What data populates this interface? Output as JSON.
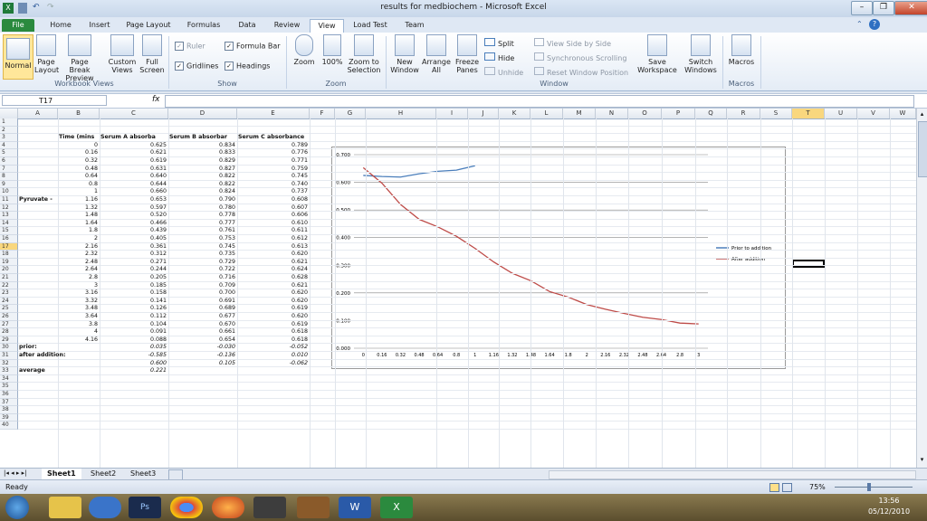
{
  "window": {
    "title": "results for medbiochem  -  Microsoft Excel"
  },
  "tabs": [
    "File",
    "Home",
    "Insert",
    "Page Layout",
    "Formulas",
    "Data",
    "Review",
    "View",
    "Load Test",
    "Team"
  ],
  "ribbon": {
    "workbook_views": {
      "label": "Workbook Views",
      "items": [
        "Normal",
        "Page Layout",
        "Page Break Preview",
        "Custom Views",
        "Full Screen"
      ]
    },
    "show": {
      "label": "Show",
      "items": [
        {
          "text": "Ruler",
          "checked": true,
          "enabled": false
        },
        {
          "text": "Formula Bar",
          "checked": true,
          "enabled": true
        },
        {
          "text": "Gridlines",
          "checked": true,
          "enabled": true
        },
        {
          "text": "Headings",
          "checked": true,
          "enabled": true
        }
      ]
    },
    "zoom": {
      "label": "Zoom",
      "items": [
        "Zoom",
        "100%",
        "Zoom to Selection"
      ]
    },
    "window": {
      "label": "Window",
      "items": [
        "New Window",
        "Arrange All",
        "Freeze Panes",
        "Split",
        "Hide",
        "Unhide",
        "View Side by Side",
        "Synchronous Scrolling",
        "Reset Window Position",
        "Save Workspace",
        "Switch Windows"
      ]
    },
    "macros": {
      "label": "Macros",
      "items": [
        "Macros"
      ]
    }
  },
  "formula_bar": {
    "name_box": "T17",
    "fx": "fx",
    "value": ""
  },
  "columns": [
    "A",
    "B",
    "C",
    "D",
    "E",
    "F",
    "G",
    "H",
    "I",
    "J",
    "K",
    "L",
    "M",
    "N",
    "O",
    "P",
    "Q",
    "R",
    "S",
    "T",
    "U",
    "V",
    "W"
  ],
  "rows": 40,
  "sheet": {
    "headers": {
      "b": "Time (mins",
      "c": "Serum A absorba",
      "d": "Serum B absorbar",
      "e": "Serum C absorbance"
    },
    "pyruvate_label": "Pyruvate -",
    "data": [
      [
        "0",
        "0.625",
        "0.834",
        "0.789"
      ],
      [
        "0.16",
        "0.621",
        "0.833",
        "0.776"
      ],
      [
        "0.32",
        "0.619",
        "0.829",
        "0.771"
      ],
      [
        "0.48",
        "0.631",
        "0.827",
        "0.759"
      ],
      [
        "0.64",
        "0.640",
        "0.822",
        "0.745"
      ],
      [
        "0.8",
        "0.644",
        "0.822",
        "0.740"
      ],
      [
        "1",
        "0.660",
        "0.824",
        "0.737"
      ],
      [
        "1.16",
        "0.653",
        "0.790",
        "0.608"
      ],
      [
        "1.32",
        "0.597",
        "0.780",
        "0.607"
      ],
      [
        "1.48",
        "0.520",
        "0.778",
        "0.606"
      ],
      [
        "1.64",
        "0.466",
        "0.777",
        "0.610"
      ],
      [
        "1.8",
        "0.439",
        "0.761",
        "0.611"
      ],
      [
        "2",
        "0.405",
        "0.753",
        "0.612"
      ],
      [
        "2.16",
        "0.361",
        "0.745",
        "0.613"
      ],
      [
        "2.32",
        "0.312",
        "0.735",
        "0.620"
      ],
      [
        "2.48",
        "0.271",
        "0.729",
        "0.621"
      ],
      [
        "2.64",
        "0.244",
        "0.722",
        "0.624"
      ],
      [
        "2.8",
        "0.205",
        "0.716",
        "0.628"
      ],
      [
        "3",
        "0.185",
        "0.709",
        "0.621"
      ],
      [
        "3.16",
        "0.158",
        "0.700",
        "0.620"
      ],
      [
        "3.32",
        "0.141",
        "0.691",
        "0.620"
      ],
      [
        "3.48",
        "0.126",
        "0.689",
        "0.619"
      ],
      [
        "3.64",
        "0.112",
        "0.677",
        "0.620"
      ],
      [
        "3.8",
        "0.104",
        "0.670",
        "0.619"
      ],
      [
        "4",
        "0.091",
        "0.661",
        "0.618"
      ],
      [
        "4.16",
        "0.088",
        "0.654",
        "0.618"
      ]
    ],
    "prior": {
      "label": "prior:",
      "c": "0.035",
      "d": "-0.030",
      "e": "-0.052"
    },
    "after": {
      "label": "after addition:",
      "c": "-0.585",
      "d": "-0.136",
      "e": "0.010"
    },
    "row32": {
      "c": "0.600",
      "d": "0.105",
      "e": "-0.062"
    },
    "average": {
      "label": "average",
      "c": "0.221"
    }
  },
  "chart_data": {
    "type": "line",
    "x": [
      "0",
      "0.16",
      "0.32",
      "0.48",
      "0.64",
      "0.8",
      "1",
      "1.16",
      "1.32",
      "1.48",
      "1.64",
      "1.8",
      "2",
      "2.16",
      "2.32",
      "2.48",
      "2.64",
      "2.8",
      "3"
    ],
    "yticks": [
      "0.000",
      "0.100",
      "0.200",
      "0.300",
      "0.400",
      "0.500",
      "0.600",
      "0.700"
    ],
    "ylim": [
      0,
      0.7
    ],
    "series": [
      {
        "name": "Prior to addition",
        "color": "#4a7ebb",
        "values": [
          0.625,
          0.621,
          0.619,
          0.631,
          0.64,
          0.644,
          0.66
        ]
      },
      {
        "name": "After addition",
        "color": "#be4b48",
        "values": [
          0.653,
          0.597,
          0.52,
          0.466,
          0.439,
          0.405,
          0.361,
          0.312,
          0.271,
          0.244,
          0.205,
          0.185,
          0.158,
          0.141,
          0.126,
          0.112,
          0.104,
          0.091,
          0.088
        ]
      }
    ],
    "legend": "right"
  },
  "sheet_tabs": [
    "Sheet1",
    "Sheet2",
    "Sheet3"
  ],
  "status": {
    "left": "Ready",
    "zoom": "75%"
  },
  "taskbar": {
    "time": "13:56",
    "date": "05/12/2010"
  }
}
